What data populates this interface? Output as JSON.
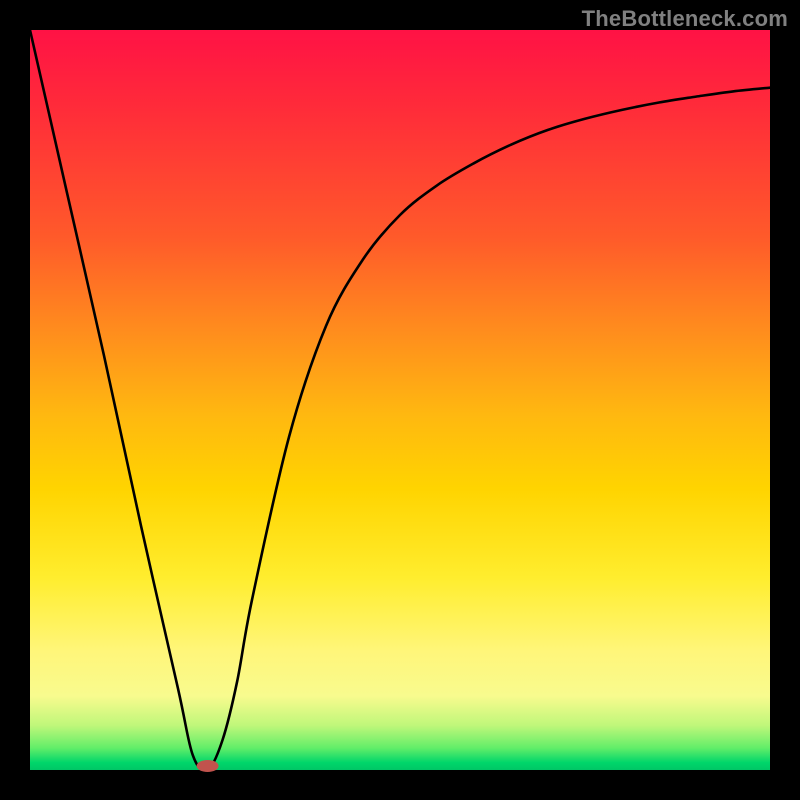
{
  "attribution": "TheBottleneck.com",
  "colors": {
    "frame": "#000000",
    "gradient_top": "#ff1245",
    "gradient_mid": "#ffd400",
    "gradient_bottom": "#00c666",
    "curve": "#000000",
    "marker": "#c1534d"
  },
  "chart_data": {
    "type": "line",
    "title": "",
    "xlabel": "",
    "ylabel": "",
    "xlim": [
      0,
      100
    ],
    "ylim": [
      0,
      100
    ],
    "series": [
      {
        "name": "bottleneck-curve",
        "x": [
          0,
          5,
          10,
          15,
          20,
          22,
          24,
          26,
          28,
          30,
          35,
          40,
          45,
          50,
          55,
          60,
          65,
          70,
          75,
          80,
          85,
          90,
          95,
          100
        ],
        "y": [
          100,
          78,
          56,
          33,
          11,
          2,
          0,
          4,
          12,
          23,
          45,
          60,
          69,
          75,
          79,
          82,
          84.5,
          86.5,
          88,
          89.2,
          90.2,
          91,
          91.7,
          92.2
        ]
      }
    ],
    "marker": {
      "x": 24,
      "y": 0,
      "shape": "pill"
    }
  }
}
